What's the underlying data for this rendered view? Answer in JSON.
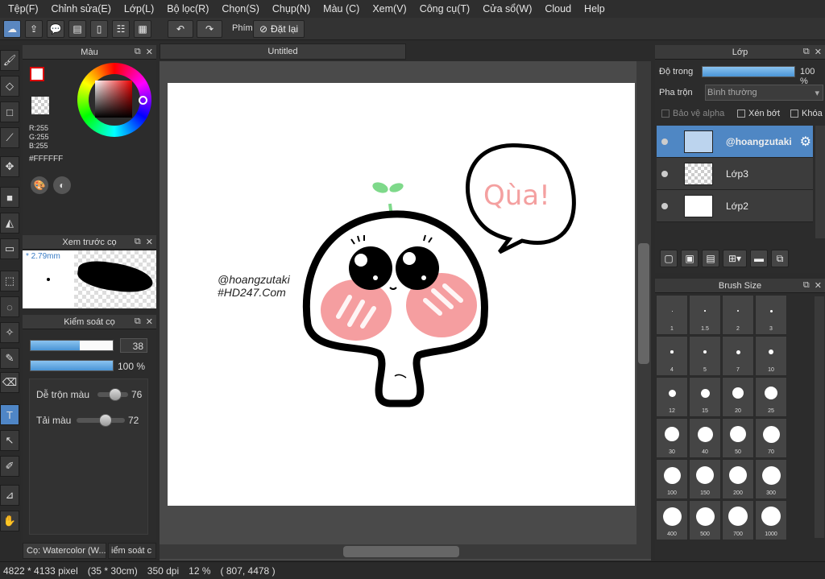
{
  "menu": [
    "Tệp(F)",
    "Chỉnh sửa(E)",
    "Lớp(L)",
    "Bộ lọc(R)",
    "Chọn(S)",
    "Chụp(N)",
    "Màu (C)",
    "Xem(V)",
    "Công cụ(T)",
    "Cửa sổ(W)",
    "Cloud",
    "Help"
  ],
  "toolbar": {
    "shortcut_label": "Phím",
    "reset_label": "Đặt lại"
  },
  "color_panel": {
    "title": "Màu",
    "r": "R:255",
    "g": "G:255",
    "b": "B:255",
    "hex": "#FFFFFF"
  },
  "brush_preview": {
    "title": "Xem trước cọ",
    "size": "* 2.79mm"
  },
  "brush_control": {
    "title": "Kiểm soát cọ",
    "size_value": "38",
    "opacity_value": "100 %",
    "mix_label": "Dễ trộn màu",
    "mix_value": "76",
    "load_label": "Tải màu",
    "load_value": "72",
    "size_fill": 0.6,
    "opacity_fill": 1.0
  },
  "document_tab": "Untitled",
  "canvas_text": {
    "watermark1": "@hoangzutaki",
    "watermark2": "#HD247.Com",
    "bubble": "Qùa!"
  },
  "layer_panel": {
    "title": "Lớp",
    "opacity_label": "Độ trong",
    "opacity_value": "100 %",
    "opacity_fill": 1.0,
    "blend_label": "Pha trộn",
    "blend_value": "Bình thường",
    "protect_alpha": "Bảo vệ alpha",
    "clipping": "Xén bớt",
    "lock": "Khóa",
    "layers": [
      {
        "name": "@hoangzutaki"
      },
      {
        "name": "Lớp3"
      },
      {
        "name": "Lớp2"
      }
    ]
  },
  "brush_size_panel": {
    "title": "Brush Size",
    "sizes": [
      "1",
      "1.5",
      "2",
      "3",
      "4",
      "5",
      "7",
      "10",
      "12",
      "15",
      "20",
      "25",
      "30",
      "40",
      "50",
      "70",
      "100",
      "150",
      "200",
      "300",
      "400",
      "500",
      "700",
      "1000"
    ]
  },
  "bottom_tabs": {
    "brush_tab": "Cọ: Watercolor (W...",
    "control_tab": "iểm soát c"
  },
  "status": {
    "pixels": "4822 * 4133 pixel",
    "cm": "(35 * 30cm)",
    "dpi": "350 dpi",
    "zoom": "12 %",
    "coords": "( 807, 4478 )"
  },
  "colors": {
    "accent": "#4f87c4",
    "bubble_text": "#f4a0a0",
    "cheek": "#f59ea0",
    "sprout": "#7ed98a"
  }
}
